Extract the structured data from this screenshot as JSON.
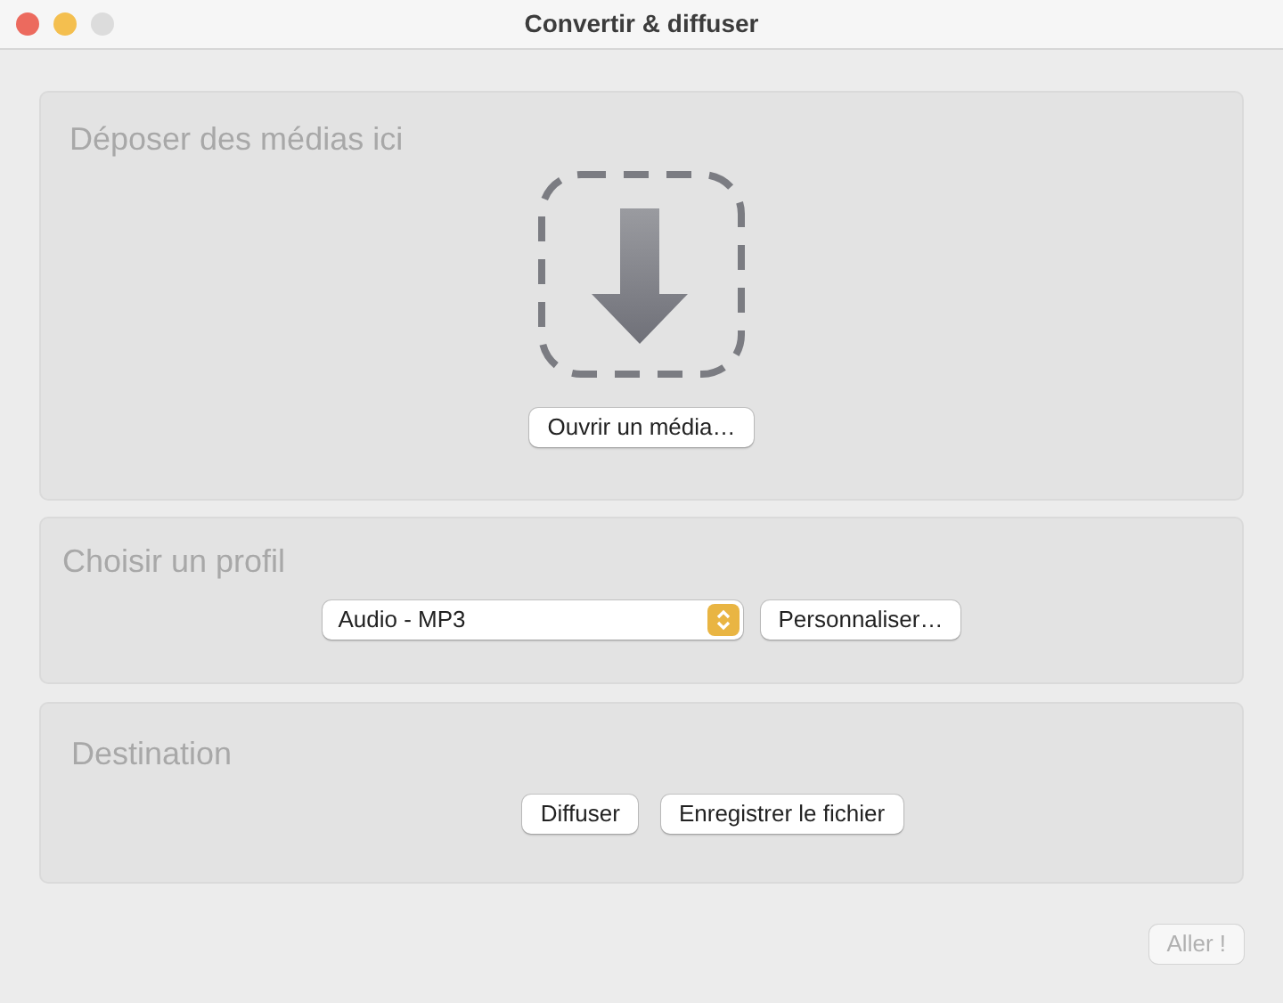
{
  "window": {
    "title": "Convertir & diffuser"
  },
  "drop_zone": {
    "heading": "Déposer des médias ici",
    "open_button": "Ouvrir un média…"
  },
  "profile": {
    "heading": "Choisir un profil",
    "select_value": "Audio - MP3",
    "customize_button": "Personnaliser…"
  },
  "destination": {
    "heading": "Destination",
    "buttons": [
      "Diffuser",
      "Enregistrer le fichier"
    ]
  },
  "go_button": {
    "label": "Aller !",
    "disabled": true
  }
}
